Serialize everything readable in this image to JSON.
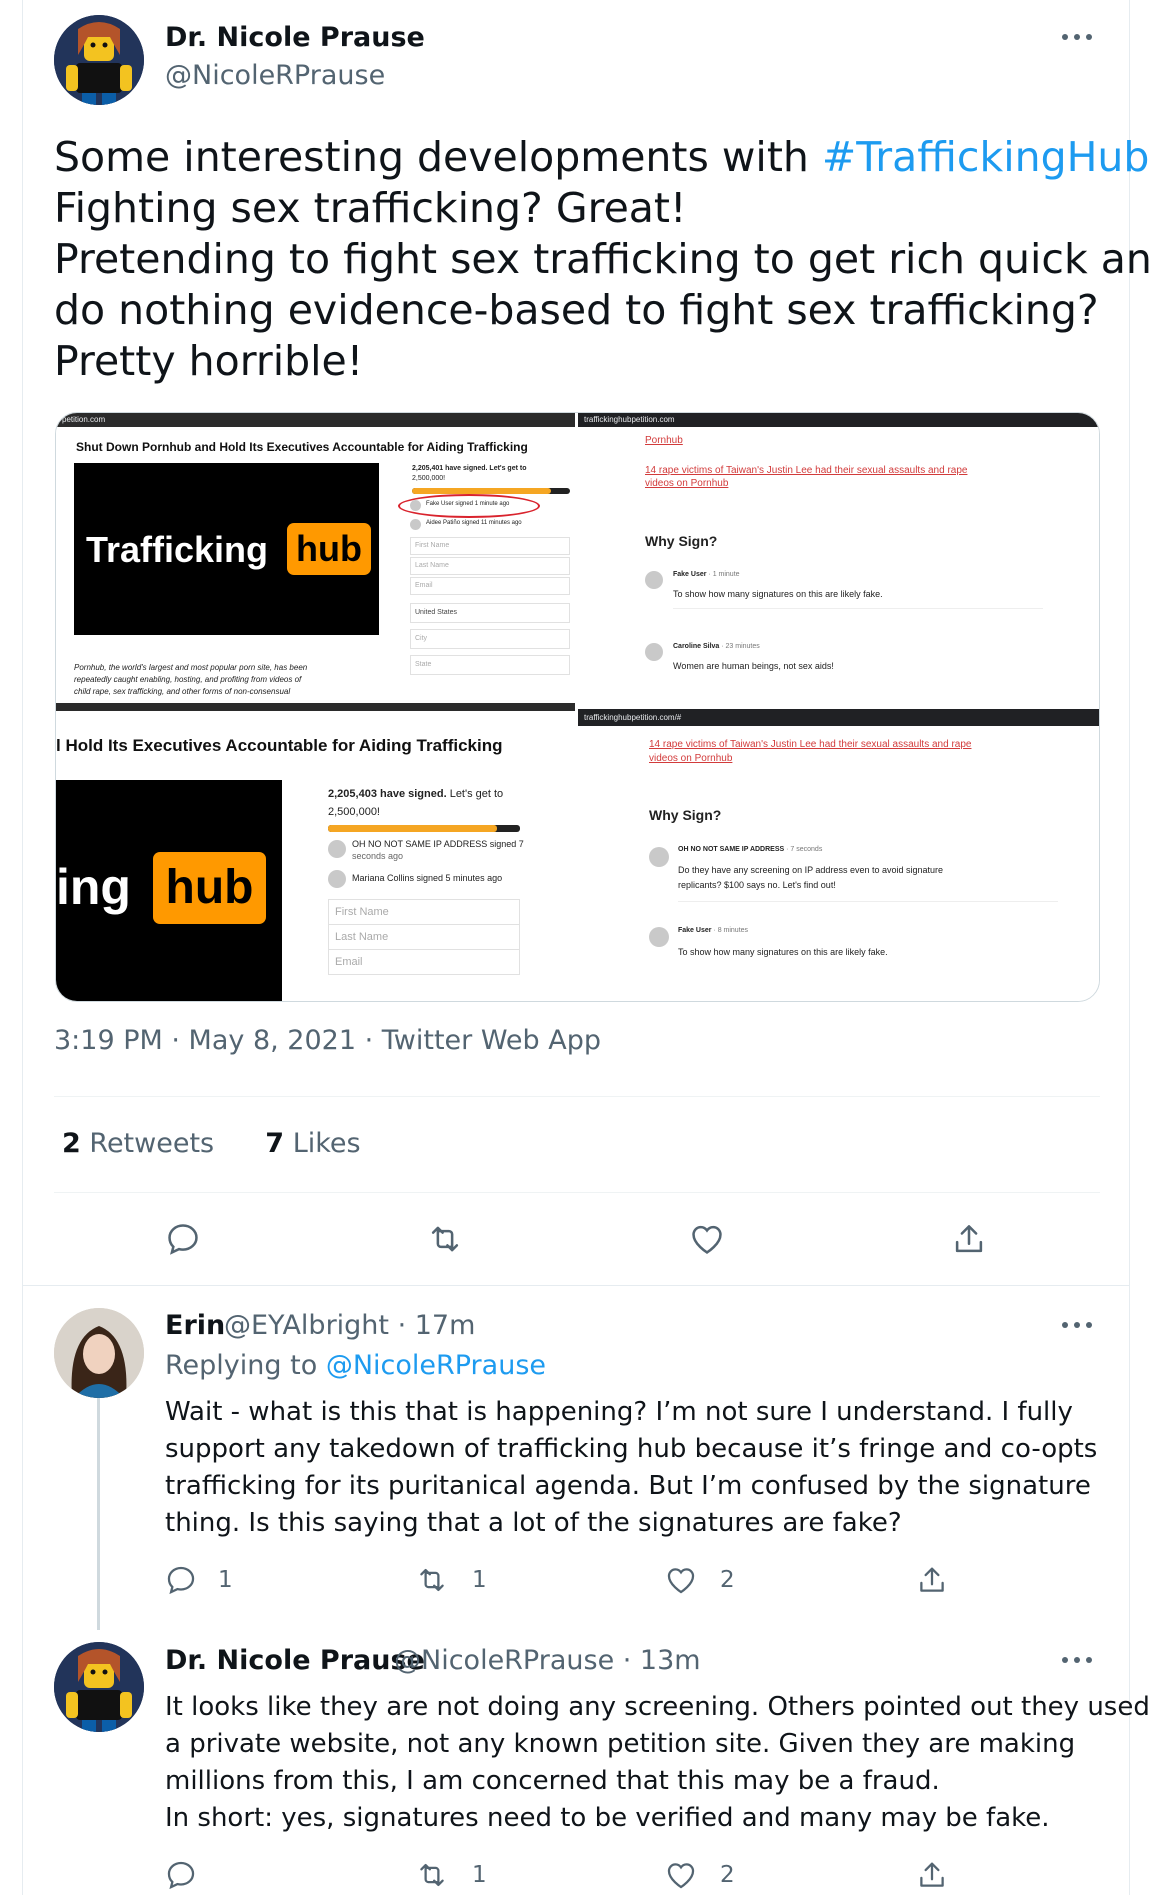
{
  "main_tweet": {
    "author_name": "Dr. Nicole Prause",
    "author_handle": "@NicoleRPrause",
    "text_lines": [
      {
        "before": "Some interesting developments with ",
        "hashtag": "#TraffickingHub",
        "after": "."
      },
      {
        "text": "Fighting sex trafficking? Great!"
      },
      {
        "text": "Pretending to fight sex trafficking to get rich quick and"
      },
      {
        "text": "do nothing evidence-based to fight sex trafficking?"
      },
      {
        "text": "Pretty horrible!"
      }
    ],
    "timestamp": "3:19 PM · May 8, 2021 · Twitter Web App",
    "retweets_count": "2",
    "retweets_label": "Retweets",
    "likes_count": "7",
    "likes_label": "Likes"
  },
  "media": {
    "tl": {
      "url": "petition.com",
      "title": "Shut Down Pornhub and Hold Its Executives Accountable for Aiding Trafficking",
      "logo_word": "Trafficking",
      "logo_hub": "hub",
      "signed_line1": "2,205,401 have signed. Let's get to",
      "signed_line2": "2,500,000!",
      "signer1": "Fake User signed 1 minute ago",
      "signer2": "Aidee Patiño signed 11 minutes ago",
      "fields": [
        "First Name",
        "Last Name",
        "Email",
        "United States",
        "City",
        "State"
      ],
      "caption_lines": [
        "Pornhub, the world's largest and most popular porn site, has been",
        "repeatedly caught enabling, hosting, and profiting from videos of",
        "child rape, sex trafficking, and other forms of non-consensual"
      ]
    },
    "tr": {
      "url": "traffickinghubpetition.com",
      "link_top": "Pornhub",
      "link_line1": "14 rape victims of Taiwan's Justin Lee had their sexual assaults and rape",
      "link_line2": "videos on Pornhub",
      "why": "Why Sign?",
      "c1_name": "Fake User",
      "c1_time": " · 1 minute",
      "c1_text": "To show how many signatures on this are likely fake.",
      "c2_name": "Caroline Silva",
      "c2_time": " · 23 minutes",
      "c2_text": "Women are human beings, not sex aids!"
    },
    "bl": {
      "title": "l Hold Its Executives Accountable for Aiding Trafficking",
      "logo_word": "ing",
      "logo_hub": "hub",
      "signed_bold": "2,205,403 have signed.",
      "signed_rest": " Let's get to",
      "signed_line2": "2,500,000!",
      "signer1_line1": "OH NO NOT SAME IP ADDRESS signed 7",
      "signer1_line2": "seconds ago",
      "signer2": "Mariana Collins signed 5 minutes ago",
      "fields": [
        "First Name",
        "Last Name",
        "Email"
      ]
    },
    "br": {
      "url": "traffickinghubpetition.com/#",
      "link_line1": "14 rape victims of Taiwan's Justin Lee had their sexual assaults and rape",
      "link_line2": "videos on Pornhub",
      "why": "Why Sign?",
      "c1_name": "OH NO NOT SAME IP ADDRESS",
      "c1_time": " · 7 seconds",
      "c1_text1": "Do they have any screening on IP address even to avoid signature",
      "c1_text2": "replicants? $100 says no. Let's find out!",
      "c2_name": "Fake User",
      "c2_time": " · 8 minutes",
      "c2_text": "To show how many signatures on this are likely fake."
    }
  },
  "reply1": {
    "author_name": "Erin",
    "meta": "@EYAlbright · 17m",
    "replying_label": "Replying to ",
    "replying_mention": "@NicoleRPrause",
    "text_lines": [
      "Wait - what is this that is happening? I’m not sure I understand. I fully",
      "support any takedown of trafficking hub because it’s fringe and co-opts",
      "trafficking for its puritanical agenda. But I’m confused by the signature",
      "thing. Is this saying that a lot of the signatures are fake?"
    ],
    "reply_count": "1",
    "retweet_count": "1",
    "like_count": "2"
  },
  "reply2": {
    "author_name": "Dr. Nicole Prause",
    "meta": "@NicoleRPrause · 13m",
    "text_lines": [
      "It looks like they are not doing any screening. Others pointed out they used",
      "a private website, not any known petition site. Given they are making",
      "millions from this, I am concerned that this may be a fraud.",
      "In short: yes, signatures need to be verified and many may be fake."
    ],
    "reply_count": "",
    "retweet_count": "1",
    "like_count": "2"
  },
  "colors": {
    "accent": "#1d9bf0",
    "secondary_text": "#536471",
    "brand_orange": "#ff9900",
    "link_red": "#d23b3b"
  },
  "icons": [
    "more-icon",
    "reply-icon",
    "retweet-icon",
    "like-icon",
    "share-icon"
  ]
}
